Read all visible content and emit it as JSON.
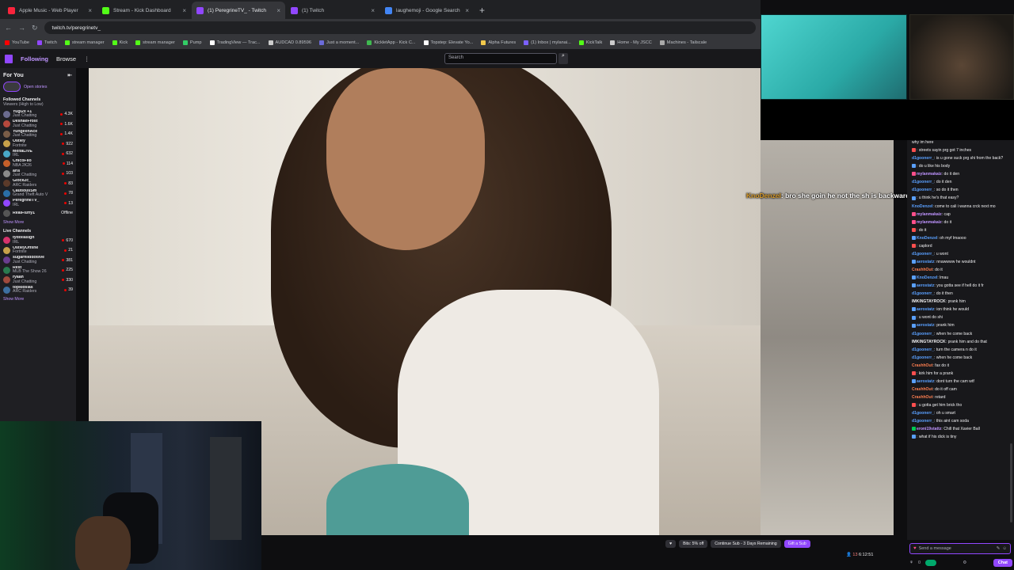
{
  "browser": {
    "tabs": [
      {
        "title": "Apple Music - Web Player",
        "color": "#fa243c",
        "active": false
      },
      {
        "title": "Stream - Kick Dashboard",
        "color": "#53fc18",
        "active": false
      },
      {
        "title": "(1) PeregrineTV_ - Twitch",
        "color": "#9147ff",
        "active": true
      },
      {
        "title": "(1) Twitch",
        "color": "#9147ff",
        "active": false
      },
      {
        "title": "laughemoji - Google Search",
        "color": "#4285f4",
        "active": false
      }
    ],
    "new_tab": "+",
    "url": "twitch.tv/peregrinetv_",
    "bookmarks": [
      {
        "label": "YouTube",
        "color": "#ff0000"
      },
      {
        "label": "Twitch",
        "color": "#9147ff"
      },
      {
        "label": "stream manager",
        "color": "#53fc18"
      },
      {
        "label": "Kick",
        "color": "#53fc18"
      },
      {
        "label": "stream manager",
        "color": "#53fc18"
      },
      {
        "label": "Pump",
        "color": "#33cc66"
      },
      {
        "label": "TradingView — Trac...",
        "color": "#ffffff"
      },
      {
        "label": "AUDCAD 0.89596",
        "color": "#cccccc"
      },
      {
        "label": "Just a moment...",
        "color": "#6b6bd9"
      },
      {
        "label": "KickletApp - Kick C...",
        "color": "#3fb950"
      },
      {
        "label": "Topstep: Elevate Yo...",
        "color": "#ffffff"
      },
      {
        "label": "Alpha Futures",
        "color": "#f2c94c"
      },
      {
        "label": "(1) Inbox | mylanai...",
        "color": "#7b61ff"
      },
      {
        "label": "KickTalk",
        "color": "#53fc18"
      },
      {
        "label": "Home - My JSCC",
        "color": "#cccccc"
      },
      {
        "label": "Machines - Tailscale",
        "color": "#aaaaaa"
      }
    ]
  },
  "twitch_nav": {
    "following": "Following",
    "browse": "Browse",
    "more": "⋮",
    "search_placeholder": "Search",
    "search_icon": "🔍"
  },
  "sidebar": {
    "for_you": "For You",
    "collapse_icon": "⇤",
    "open_stories": "Open stories",
    "followed_title": "Followed Channels",
    "followed_sort": "Viewers (High to Low)",
    "followed": [
      {
        "name": "Yugi2x +1",
        "game": "Just Chatting",
        "viewers": "4.3K",
        "color": "#6b6b8f"
      },
      {
        "name": "DeshaeFrost",
        "game": "Just Chatting",
        "viewers": "1.6K",
        "color": "#b5483d"
      },
      {
        "name": "YungeenAce",
        "game": "Just Chatting",
        "viewers": "1.4K",
        "color": "#7a5d48"
      },
      {
        "name": "Ostley",
        "game": "Fortnite",
        "viewers": "922",
        "color": "#c7a14a"
      },
      {
        "name": "MeltaLIVE",
        "game": "IRL",
        "viewers": "632",
        "color": "#48a8c7"
      },
      {
        "name": "ChicoFllo",
        "game": "NBA 2K26",
        "viewers": "114",
        "color": "#c45f2a"
      },
      {
        "name": "aris",
        "game": "Just Chatting",
        "viewers": "103",
        "color": "#8a8a8a"
      },
      {
        "name": "Glock2c_",
        "game": "ARC Raiders",
        "viewers": "83",
        "color": "#5b3a2a"
      },
      {
        "name": "CautiousSm",
        "game": "Grand Theft Auto V",
        "viewers": "78",
        "color": "#2a6ea6"
      },
      {
        "name": "PeregrineTV_",
        "game": "IRL",
        "viewers": "13",
        "color": "#9147ff"
      },
      {
        "name": "RealFluffy1",
        "game": "",
        "viewers": "Offline",
        "color": "#555555"
      }
    ],
    "show_more": "Show More",
    "live_title": "Live Channels",
    "live": [
      {
        "name": "tydollasign",
        "game": "IRL",
        "viewers": "670",
        "color": "#d6336c"
      },
      {
        "name": "OstleyOffline",
        "game": "Fortnite",
        "viewers": "21",
        "color": "#c7a14a"
      },
      {
        "name": "sugarhilddotlive",
        "game": "Just Chatting",
        "viewers": "381",
        "color": "#6a3d8f"
      },
      {
        "name": "Rest",
        "game": "MLB The Show 26",
        "viewers": "225",
        "color": "#2a7a4f"
      },
      {
        "name": "ryaah",
        "game": "Just Chatting",
        "viewers": "330",
        "color": "#a04a3d"
      },
      {
        "name": "topkidslas",
        "game": "ARC Raiders",
        "viewers": "39",
        "color": "#3d6fa0"
      }
    ],
    "show_more_2": "Show More"
  },
  "overlay_chat": {
    "user": "KnoDenzel",
    "text": ": bro she goin he not the sh is backwards"
  },
  "chat": {
    "messages": [
      {
        "user": "",
        "text": "why im here",
        "color": "#efeff1",
        "badge": ""
      },
      {
        "user": "",
        "text": ": streets sayin prg got 7 inches",
        "color": "#ff4f4f",
        "badge": "#ff4f4f"
      },
      {
        "user": "d1goonerr_",
        "text": ": is u gone suck prg shi from the back?",
        "color": "#5aa0ff",
        "badge": ""
      },
      {
        "user": "",
        "text": ": do u like his body",
        "color": "#ff4f4f",
        "badge": "#5aa0ff"
      },
      {
        "user": "mylanmakaiz",
        "text": ": do it den",
        "color": "#bf94ff",
        "badge": "#ff4f8b"
      },
      {
        "user": "d1goonerr_",
        "text": ": do it den",
        "color": "#5aa0ff",
        "badge": ""
      },
      {
        "user": "d1goonerr_",
        "text": ": so do it then",
        "color": "#5aa0ff",
        "badge": ""
      },
      {
        "user": "",
        "text": ": u think he's that easy?",
        "color": "#ff4f4f",
        "badge": "#5aa0ff"
      },
      {
        "user": "KnoDenzel",
        "text": ": come to cali i wanna crck next mo",
        "color": "#5aa0ff",
        "badge": ""
      },
      {
        "user": "mylanmakaiz",
        "text": ": cap",
        "color": "#bf94ff",
        "badge": "#ff4f8b"
      },
      {
        "user": "mylanmakaiz",
        "text": ": do it",
        "color": "#bf94ff",
        "badge": "#ff4f8b"
      },
      {
        "user": "",
        "text": ": do it",
        "color": "#ff4f4f",
        "badge": "#ff4f4f"
      },
      {
        "user": "KnoDenzel",
        "text": ": oh myf lmaooo",
        "color": "#5aa0ff",
        "badge": "#5aa0ff"
      },
      {
        "user": "",
        "text": ": caplord",
        "color": "#ff4f4f",
        "badge": "#ff4f4f"
      },
      {
        "user": "d1goonerr_",
        "text": ": u wont",
        "color": "#5aa0ff",
        "badge": ""
      },
      {
        "user": "aerostatz",
        "text": ": nnawwww he wouldnt",
        "color": "#5aa0ff",
        "badge": "#5aa0ff"
      },
      {
        "user": "CrashhOut",
        "text": ": do it",
        "color": "#ff7f50",
        "badge": ""
      },
      {
        "user": "KnoDenzel",
        "text": ": lmau",
        "color": "#5aa0ff",
        "badge": "#5aa0ff"
      },
      {
        "user": "aerostatz",
        "text": ": you gotta see if hell do it fr",
        "color": "#5aa0ff",
        "badge": "#5aa0ff"
      },
      {
        "user": "d1goonerr_",
        "text": ": do it then",
        "color": "#5aa0ff",
        "badge": ""
      },
      {
        "user": "IMKINGTAYROCK",
        "text": ": prank him",
        "color": "#efeff1",
        "badge": ""
      },
      {
        "user": "aerostatz",
        "text": ": ion think he would",
        "color": "#5aa0ff",
        "badge": "#5aa0ff"
      },
      {
        "user": "",
        "text": ": u wont do shi",
        "color": "#ff4f4f",
        "badge": "#5aa0ff"
      },
      {
        "user": "aerostatz",
        "text": ": prank him",
        "color": "#5aa0ff",
        "badge": "#5aa0ff"
      },
      {
        "user": "d1goonerr_",
        "text": ": when he come back",
        "color": "#5aa0ff",
        "badge": ""
      },
      {
        "user": "IMKINGTAYROCK",
        "text": ": prank him and do that",
        "color": "#efeff1",
        "badge": ""
      },
      {
        "user": "d1goonerr_",
        "text": ": turn the camera n do it",
        "color": "#5aa0ff",
        "badge": ""
      },
      {
        "user": "d1goonerr_",
        "text": ": when he come back",
        "color": "#5aa0ff",
        "badge": ""
      },
      {
        "user": "CrashhOut",
        "text": ": fax do it",
        "color": "#ff7f50",
        "badge": ""
      },
      {
        "user": "",
        "text": ": kirk him for a prank",
        "color": "#ff4f4f",
        "badge": "#ff4f4f"
      },
      {
        "user": "aerostatz",
        "text": ": dont turn the cam wtf",
        "color": "#5aa0ff",
        "badge": "#5aa0ff"
      },
      {
        "user": "CrashhOut",
        "text": ": do it off cam",
        "color": "#ff7f50",
        "badge": ""
      },
      {
        "user": "CrashhOut",
        "text": ": retard",
        "color": "#ff7f50",
        "badge": ""
      },
      {
        "user": "",
        "text": ": u gotta get him brick tho",
        "color": "#ff4f4f",
        "badge": "#ff4f4f"
      },
      {
        "user": "d1goonerr_",
        "text": ": oh u smart",
        "color": "#5aa0ff",
        "badge": ""
      },
      {
        "user": "d1goonerr_",
        "text": ": this aint cam soda",
        "color": "#5aa0ff",
        "badge": ""
      },
      {
        "user": "eroni19stattz",
        "text": ": Chill that Xavier Ball",
        "color": "#bf94ff",
        "badge": "#00c853"
      },
      {
        "user": "",
        "text": ": what if his dick is tiny",
        "color": "#ff4f4f",
        "badge": "#5aa0ff"
      }
    ],
    "input_placeholder": "Send a message",
    "points": "0",
    "chat_button": "Chat"
  },
  "actions": {
    "heart": "♥",
    "bits": "Bits: 5% off",
    "continue_sub": "Continue Sub - 3 Days Remaining",
    "gift": "Gift a Sub",
    "viewers": "13",
    "uptime": "6:12:51"
  }
}
